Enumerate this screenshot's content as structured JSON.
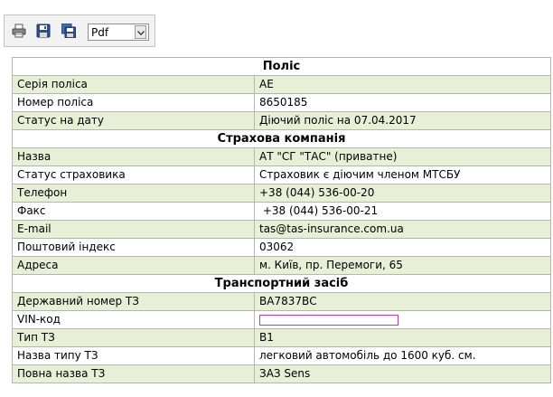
{
  "toolbar": {
    "buttons": [
      {
        "name": "print-button",
        "icon": "printer-icon"
      },
      {
        "name": "save-button",
        "icon": "floppy-disk-icon"
      },
      {
        "name": "save-all-button",
        "icon": "floppy-disks-icon"
      }
    ],
    "format_select": {
      "value": "Pdf"
    }
  },
  "colors": {
    "row_alt": "#e7efd7",
    "border": "#b5b5b5",
    "vin_border": "#c03bc0"
  },
  "sections": [
    {
      "title": "Поліс",
      "rows": [
        {
          "label": "Серія поліса",
          "value": "АЕ"
        },
        {
          "label": "Номер поліса",
          "value": "8650185"
        },
        {
          "label": "Статус на дату",
          "value": "Діючий поліс на 07.04.2017"
        }
      ]
    },
    {
      "title": "Страхова компанія",
      "rows": [
        {
          "label": "Назва",
          "value": "АТ \"СГ \"ТАС\" (приватне)"
        },
        {
          "label": "Статус страховика",
          "value": "Страховик є діючим членом МТСБУ"
        },
        {
          "label": "Телефон",
          "value": "+38 (044) 536-00-20"
        },
        {
          "label": "Факс",
          "value": " +38 (044) 536-00-21"
        },
        {
          "label": "E-mail",
          "value": "tas@tas-insurance.com.ua"
        },
        {
          "label": "Поштовий індекс",
          "value": "03062"
        },
        {
          "label": "Адреса",
          "value": "м. Київ, пр. Перемоги, 65"
        }
      ]
    },
    {
      "title": "Транспортний засіб",
      "rows": [
        {
          "label": "Державний номер ТЗ",
          "value": "ВА7837ВС"
        },
        {
          "label": "VIN-код",
          "value": "",
          "input": true
        },
        {
          "label": "Тип ТЗ",
          "value": "В1"
        },
        {
          "label": "Назва типу ТЗ",
          "value": "легковий автомобіль до 1600 куб. см."
        },
        {
          "label": "Повна назва ТЗ",
          "value": "ЗАЗ Sens"
        }
      ]
    }
  ]
}
